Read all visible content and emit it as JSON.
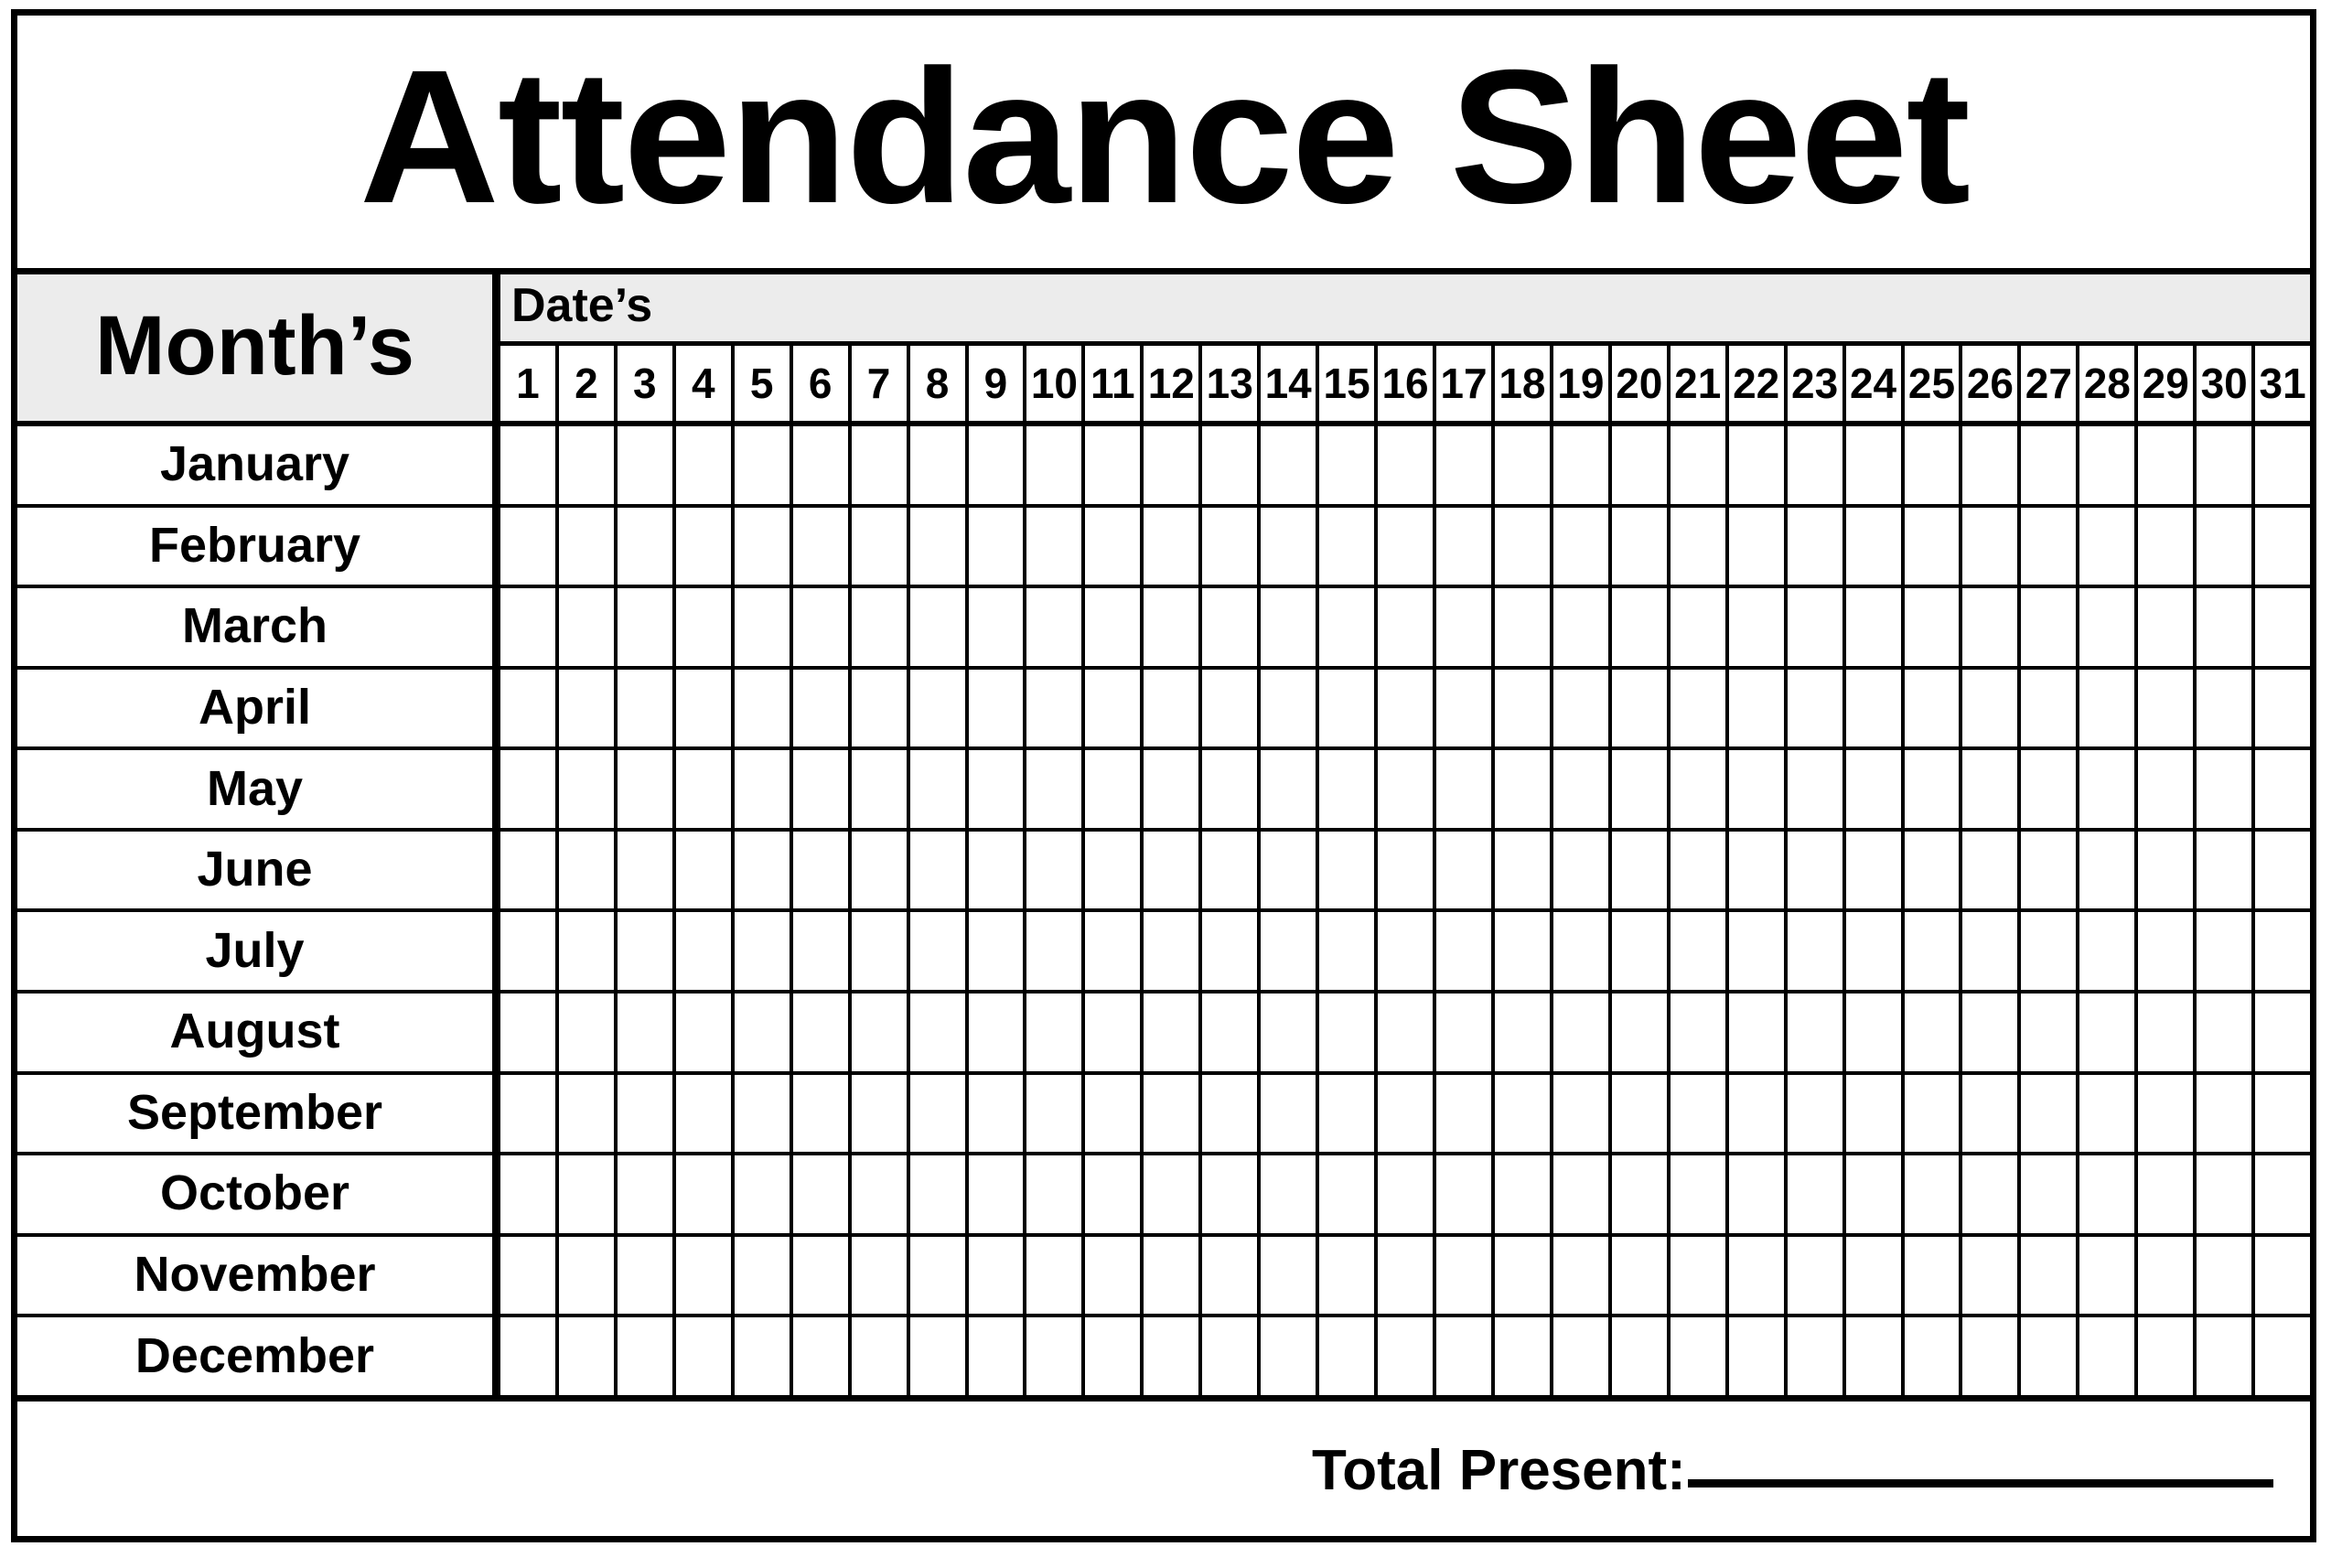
{
  "document": {
    "title": "Attendance Sheet",
    "type": "attendance-sheet",
    "colors": {
      "header_background": "#ececec",
      "cell_background": "#ffffff",
      "border": "#000000",
      "text": "#000000"
    }
  },
  "header": {
    "months_label": "Month’s",
    "dates_label": "Date’s",
    "dates": [
      "1",
      "2",
      "3",
      "4",
      "5",
      "6",
      "7",
      "8",
      "9",
      "10",
      "11",
      "12",
      "13",
      "14",
      "15",
      "16",
      "17",
      "18",
      "19",
      "20",
      "21",
      "22",
      "23",
      "24",
      "25",
      "26",
      "27",
      "28",
      "29",
      "30",
      "31"
    ]
  },
  "rows": [
    {
      "month": "January",
      "values": [
        "",
        "",
        "",
        "",
        "",
        "",
        "",
        "",
        "",
        "",
        "",
        "",
        "",
        "",
        "",
        "",
        "",
        "",
        "",
        "",
        "",
        "",
        "",
        "",
        "",
        "",
        "",
        "",
        "",
        "",
        ""
      ]
    },
    {
      "month": "February",
      "values": [
        "",
        "",
        "",
        "",
        "",
        "",
        "",
        "",
        "",
        "",
        "",
        "",
        "",
        "",
        "",
        "",
        "",
        "",
        "",
        "",
        "",
        "",
        "",
        "",
        "",
        "",
        "",
        "",
        "",
        "",
        ""
      ]
    },
    {
      "month": "March",
      "values": [
        "",
        "",
        "",
        "",
        "",
        "",
        "",
        "",
        "",
        "",
        "",
        "",
        "",
        "",
        "",
        "",
        "",
        "",
        "",
        "",
        "",
        "",
        "",
        "",
        "",
        "",
        "",
        "",
        "",
        "",
        ""
      ]
    },
    {
      "month": "April",
      "values": [
        "",
        "",
        "",
        "",
        "",
        "",
        "",
        "",
        "",
        "",
        "",
        "",
        "",
        "",
        "",
        "",
        "",
        "",
        "",
        "",
        "",
        "",
        "",
        "",
        "",
        "",
        "",
        "",
        "",
        "",
        ""
      ]
    },
    {
      "month": "May",
      "values": [
        "",
        "",
        "",
        "",
        "",
        "",
        "",
        "",
        "",
        "",
        "",
        "",
        "",
        "",
        "",
        "",
        "",
        "",
        "",
        "",
        "",
        "",
        "",
        "",
        "",
        "",
        "",
        "",
        "",
        "",
        ""
      ]
    },
    {
      "month": "June",
      "values": [
        "",
        "",
        "",
        "",
        "",
        "",
        "",
        "",
        "",
        "",
        "",
        "",
        "",
        "",
        "",
        "",
        "",
        "",
        "",
        "",
        "",
        "",
        "",
        "",
        "",
        "",
        "",
        "",
        "",
        "",
        ""
      ]
    },
    {
      "month": "July",
      "values": [
        "",
        "",
        "",
        "",
        "",
        "",
        "",
        "",
        "",
        "",
        "",
        "",
        "",
        "",
        "",
        "",
        "",
        "",
        "",
        "",
        "",
        "",
        "",
        "",
        "",
        "",
        "",
        "",
        "",
        "",
        ""
      ]
    },
    {
      "month": "August",
      "values": [
        "",
        "",
        "",
        "",
        "",
        "",
        "",
        "",
        "",
        "",
        "",
        "",
        "",
        "",
        "",
        "",
        "",
        "",
        "",
        "",
        "",
        "",
        "",
        "",
        "",
        "",
        "",
        "",
        "",
        "",
        ""
      ]
    },
    {
      "month": "September",
      "values": [
        "",
        "",
        "",
        "",
        "",
        "",
        "",
        "",
        "",
        "",
        "",
        "",
        "",
        "",
        "",
        "",
        "",
        "",
        "",
        "",
        "",
        "",
        "",
        "",
        "",
        "",
        "",
        "",
        "",
        "",
        ""
      ]
    },
    {
      "month": "October",
      "values": [
        "",
        "",
        "",
        "",
        "",
        "",
        "",
        "",
        "",
        "",
        "",
        "",
        "",
        "",
        "",
        "",
        "",
        "",
        "",
        "",
        "",
        "",
        "",
        "",
        "",
        "",
        "",
        "",
        "",
        "",
        ""
      ]
    },
    {
      "month": "November",
      "values": [
        "",
        "",
        "",
        "",
        "",
        "",
        "",
        "",
        "",
        "",
        "",
        "",
        "",
        "",
        "",
        "",
        "",
        "",
        "",
        "",
        "",
        "",
        "",
        "",
        "",
        "",
        "",
        "",
        "",
        "",
        ""
      ]
    },
    {
      "month": "December",
      "values": [
        "",
        "",
        "",
        "",
        "",
        "",
        "",
        "",
        "",
        "",
        "",
        "",
        "",
        "",
        "",
        "",
        "",
        "",
        "",
        "",
        "",
        "",
        "",
        "",
        "",
        "",
        "",
        "",
        "",
        "",
        ""
      ]
    }
  ],
  "footer": {
    "total_present_label": "Total Present:",
    "total_present_value": ""
  }
}
